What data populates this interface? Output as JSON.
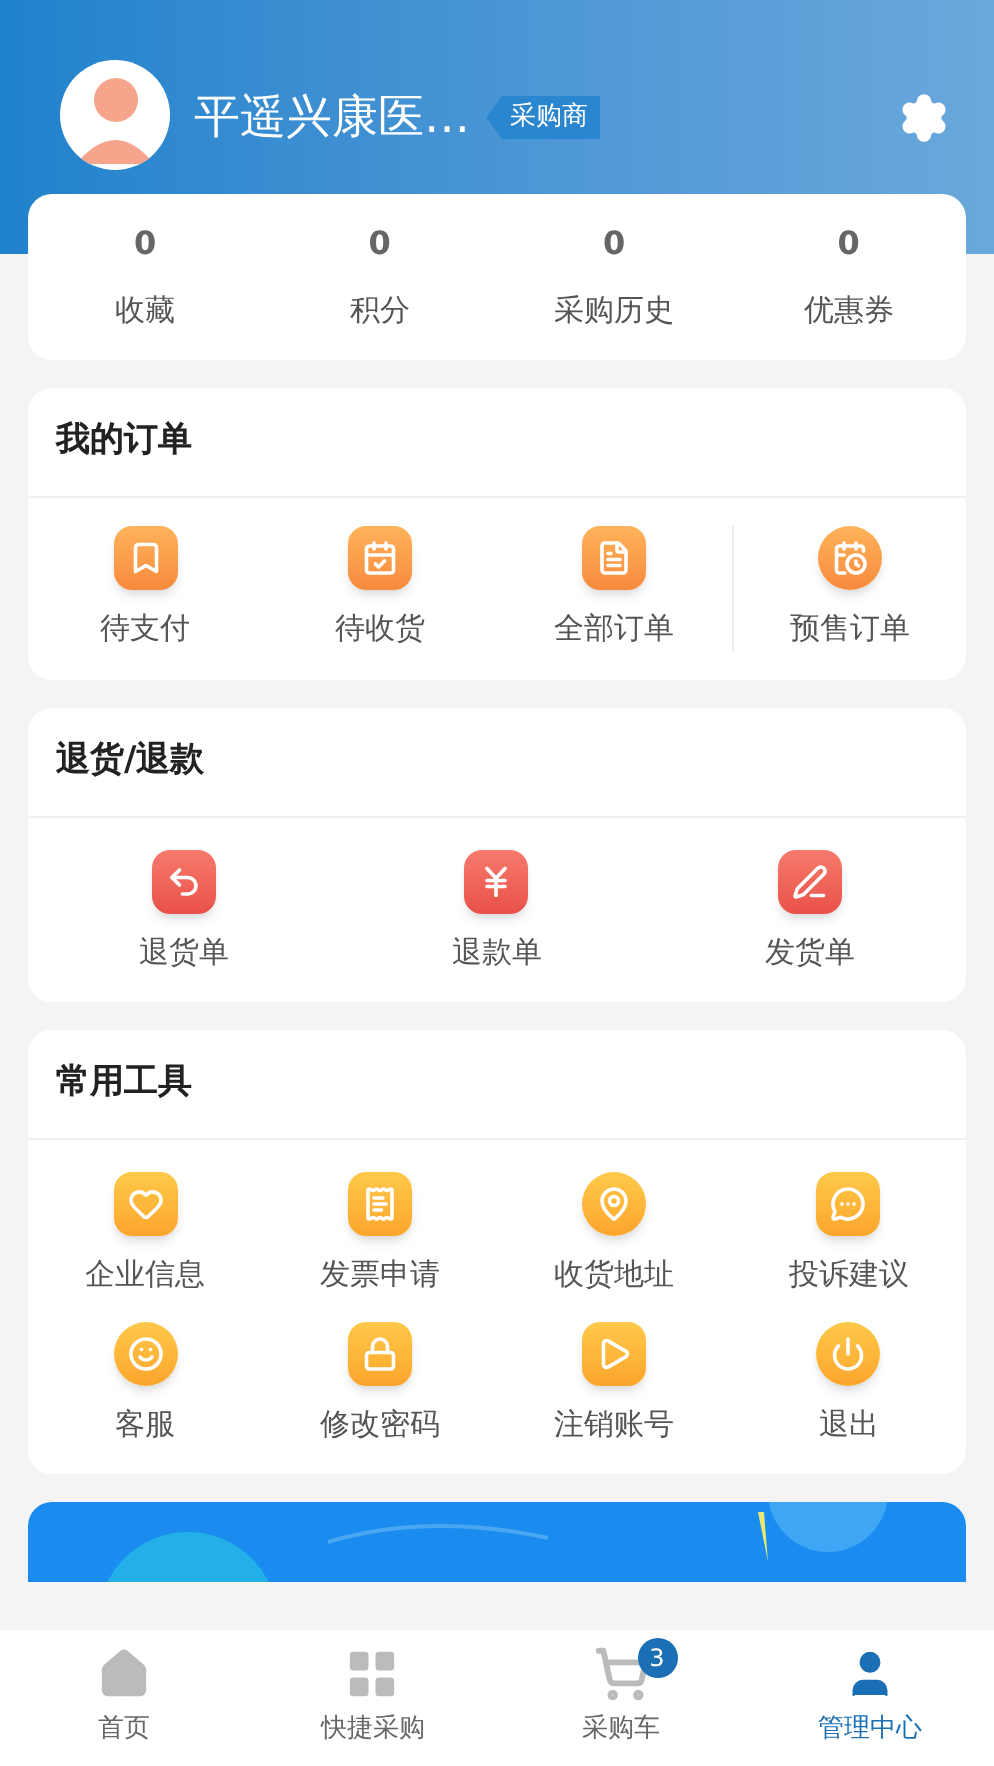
{
  "profile": {
    "name": "平遥兴康医…",
    "role_tag": "采购商"
  },
  "stats": [
    {
      "value": "0",
      "label": "收藏"
    },
    {
      "value": "0",
      "label": "积分"
    },
    {
      "value": "0",
      "label": "采购历史"
    },
    {
      "value": "0",
      "label": "优惠券"
    }
  ],
  "orders": {
    "title": "我的订单",
    "items": [
      {
        "label": "待支付"
      },
      {
        "label": "待收货"
      },
      {
        "label": "全部订单"
      },
      {
        "label": "预售订单"
      }
    ]
  },
  "returns": {
    "title": "退货/退款",
    "items": [
      {
        "label": "退货单"
      },
      {
        "label": "退款单"
      },
      {
        "label": "发货单"
      }
    ]
  },
  "tools": {
    "title": "常用工具",
    "items": [
      {
        "label": "企业信息"
      },
      {
        "label": "发票申请"
      },
      {
        "label": "收货地址"
      },
      {
        "label": "投诉建议"
      },
      {
        "label": "客服"
      },
      {
        "label": "修改密码"
      },
      {
        "label": "注销账号"
      },
      {
        "label": "退出"
      }
    ]
  },
  "tab_bar": [
    {
      "label": "首页",
      "selected": false
    },
    {
      "label": "快捷采购",
      "selected": false
    },
    {
      "label": "采购车",
      "selected": false,
      "badge": "3"
    },
    {
      "label": "管理中心",
      "selected": true
    }
  ]
}
